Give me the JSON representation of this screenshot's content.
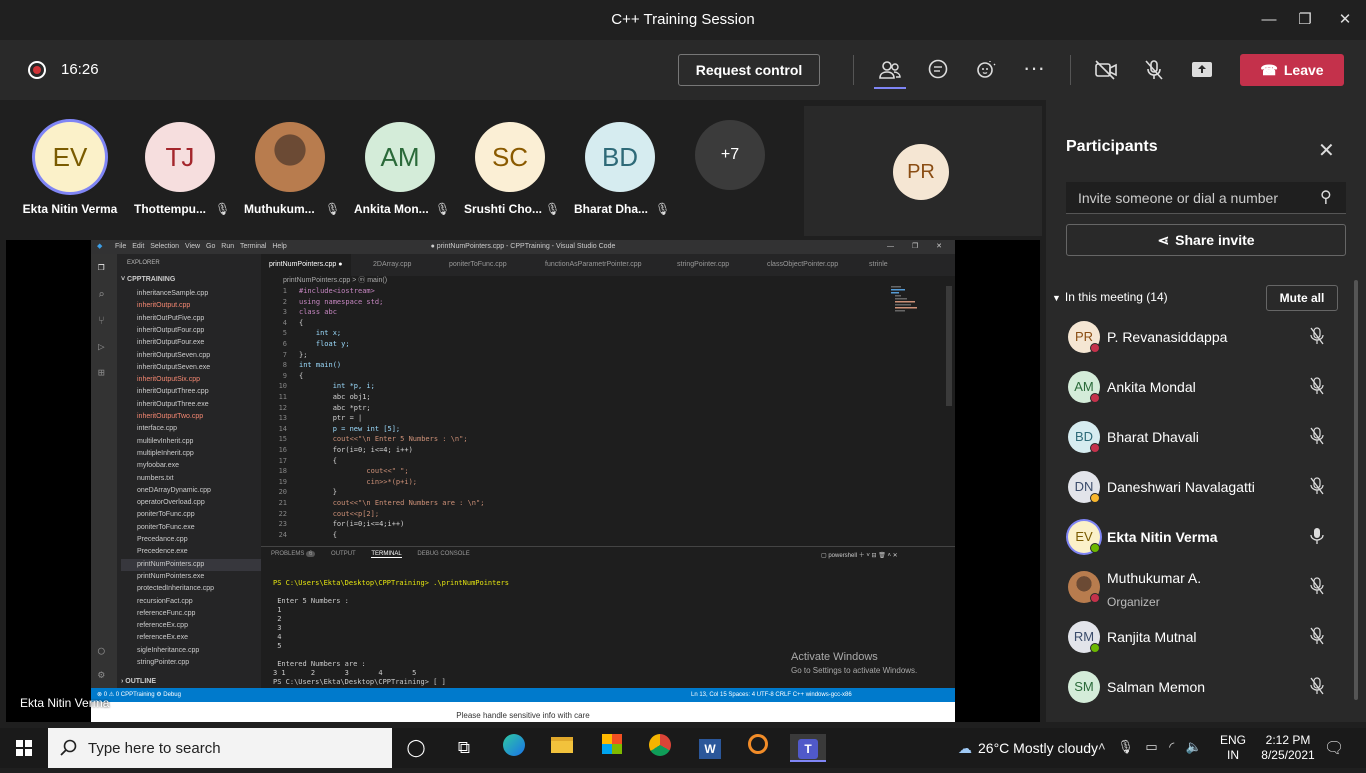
{
  "window": {
    "title": "C++ Training Session"
  },
  "toolbar": {
    "timer": "16:26",
    "request_control": "Request control",
    "leave": "Leave"
  },
  "gallery": {
    "tiles": [
      {
        "initials": "EV",
        "name": "Ekta Nitin Verma"
      },
      {
        "initials": "TJ",
        "name": "Thottempu..."
      },
      {
        "initials": "",
        "name": "Muthukum..."
      },
      {
        "initials": "AM",
        "name": "Ankita Mon..."
      },
      {
        "initials": "SC",
        "name": "Srushti Cho..."
      },
      {
        "initials": "BD",
        "name": "Bharat Dha..."
      },
      {
        "initials": "+7",
        "name": ""
      }
    ],
    "pinned_initials": "PR"
  },
  "share": {
    "sharer": "Ekta Nitin Verma",
    "vs_title": "● printNumPointers.cpp - CPPTraining - Visual Studio Code",
    "vs_menu": [
      "File",
      "Edit",
      "Selection",
      "View",
      "Go",
      "Run",
      "Terminal",
      "Help"
    ],
    "explorer_header": "EXPLORER",
    "project": "CPPTRAINING",
    "files": [
      "inheritanceSample.cpp",
      "inheritOutput.cpp",
      "inheritOutPutFive.cpp",
      "inheritOutputFour.cpp",
      "inheritOutputFour.exe",
      "inheritOutputSeven.cpp",
      "inheritOutputSeven.exe",
      "inheritOutputSix.cpp",
      "inheritOutputThree.cpp",
      "inheritOutputThree.exe",
      "inheritOutputTwo.cpp",
      "interface.cpp",
      "multilevInherit.cpp",
      "multipleInherit.cpp",
      "myfoobar.exe",
      "numbers.txt",
      "oneDArrayDynamic.cpp",
      "operatorOverload.cpp",
      "poniterToFunc.cpp",
      "poniterToFunc.exe",
      "Precedance.cpp",
      "Precedence.exe",
      "printNumPointers.cpp",
      "printNumPointers.exe",
      "protectedInheritance.cpp",
      "recursionFact.cpp",
      "referenceFunc.cpp",
      "referenceEx.cpp",
      "referenceEx.exe",
      "sigleInheritance.cpp",
      "stringPointer.cpp"
    ],
    "outline": "OUTLINE",
    "tabs": [
      "printNumPointers.cpp",
      "2DArray.cpp",
      "poniterToFunc.cpp",
      "functionAsParametrPointer.cpp",
      "stringPointer.cpp",
      "classObjectPointer.cpp",
      "strinle"
    ],
    "breadcrumb": "printNumPointers.cpp > ⓜ main()",
    "code": [
      "#include<iostream>",
      "using namespace std;",
      "class abc",
      "{",
      "    int x;",
      "    float y;",
      "};",
      "int main()",
      "{",
      "        int *p, i;",
      "        abc obj1;",
      "        abc *ptr;",
      "        ptr = |",
      "        p = new int [5];",
      "        cout<<\"\\n Enter 5 Numbers : \\n\";",
      "        for(i=0; i<=4; i++)",
      "        {",
      "                cout<<\" \";",
      "                cin>>*(p+i);",
      "        }",
      "        cout<<\"\\n Entered Numbers are : \\n\";",
      "        cout<<p[2];",
      "        for(i=0;i<=4;i++)",
      "        {"
    ],
    "panel_tabs": [
      "PROBLEMS",
      "6",
      "OUTPUT",
      "TERMINAL",
      "DEBUG CONSOLE"
    ],
    "terminal_shell": "powershell",
    "terminal": [
      "PS C:\\Users\\Ekta\\Desktop\\CPPTraining> .\\printNumPointers",
      "",
      " Enter 5 Numbers :",
      " 1",
      " 2",
      " 3",
      " 4",
      " 5",
      "",
      " Entered Numbers are :",
      "3 1      2       3       4       5",
      "PS C:\\Users\\Ekta\\Desktop\\CPPTraining> [ ]"
    ],
    "activate_title": "Activate Windows",
    "activate_sub": "Go to Settings to activate Windows.",
    "status_left": "⊗ 0 ⚠ 0    CPPTraining    ⚙ Debug",
    "status_right": "Ln 13, Col 15   Spaces: 4   UTF-8   CRLF   C++   windows-gcc-x86",
    "footer_note": "Please handle sensitive info with care"
  },
  "participants": {
    "title": "Participants",
    "invite_placeholder": "Invite someone or dial a number",
    "share_invite": "Share invite",
    "in_meeting": "In this meeting (14)",
    "mute_all": "Mute all",
    "list": [
      {
        "initials": "PR",
        "name": "P. Revanasiddappa",
        "role": "",
        "bg": "#f5e6d3",
        "fg": "#8a4d13",
        "status": "#c4314b"
      },
      {
        "initials": "AM",
        "name": "Ankita Mondal",
        "role": "",
        "bg": "#d4ecd9",
        "fg": "#2b6a3a",
        "status": "#c4314b"
      },
      {
        "initials": "BD",
        "name": "Bharat Dhavali",
        "role": "",
        "bg": "#d6ecf0",
        "fg": "#2e6a78",
        "status": "#c4314b"
      },
      {
        "initials": "DN",
        "name": "Daneshwari Navalagatti",
        "role": "",
        "bg": "#e2e4ea",
        "fg": "#3b4c6b",
        "status": "#f8b62c"
      },
      {
        "initials": "EV",
        "name": "Ekta Nitin Verma",
        "role": "",
        "bg": "#fbf1c9",
        "fg": "#7a5b00",
        "status": "#6bb700"
      },
      {
        "initials": "",
        "name": "Muthukumar A.",
        "role": "Organizer",
        "bg": "#8a5a3a",
        "fg": "#fff",
        "status": "#c4314b"
      },
      {
        "initials": "RM",
        "name": "Ranjita Mutnal",
        "role": "",
        "bg": "#e2e4ea",
        "fg": "#3b4c6b",
        "status": "#6bb700"
      },
      {
        "initials": "SM",
        "name": "Salman Memon",
        "role": "",
        "bg": "#d4ecd9",
        "fg": "#2b6a3a",
        "status": ""
      }
    ]
  },
  "taskbar": {
    "search_placeholder": "Type here to search",
    "weather": "26°C  Mostly cloudy",
    "lang": "ENG",
    "region": "IN",
    "time": "2:12 PM",
    "date": "8/25/2021"
  }
}
